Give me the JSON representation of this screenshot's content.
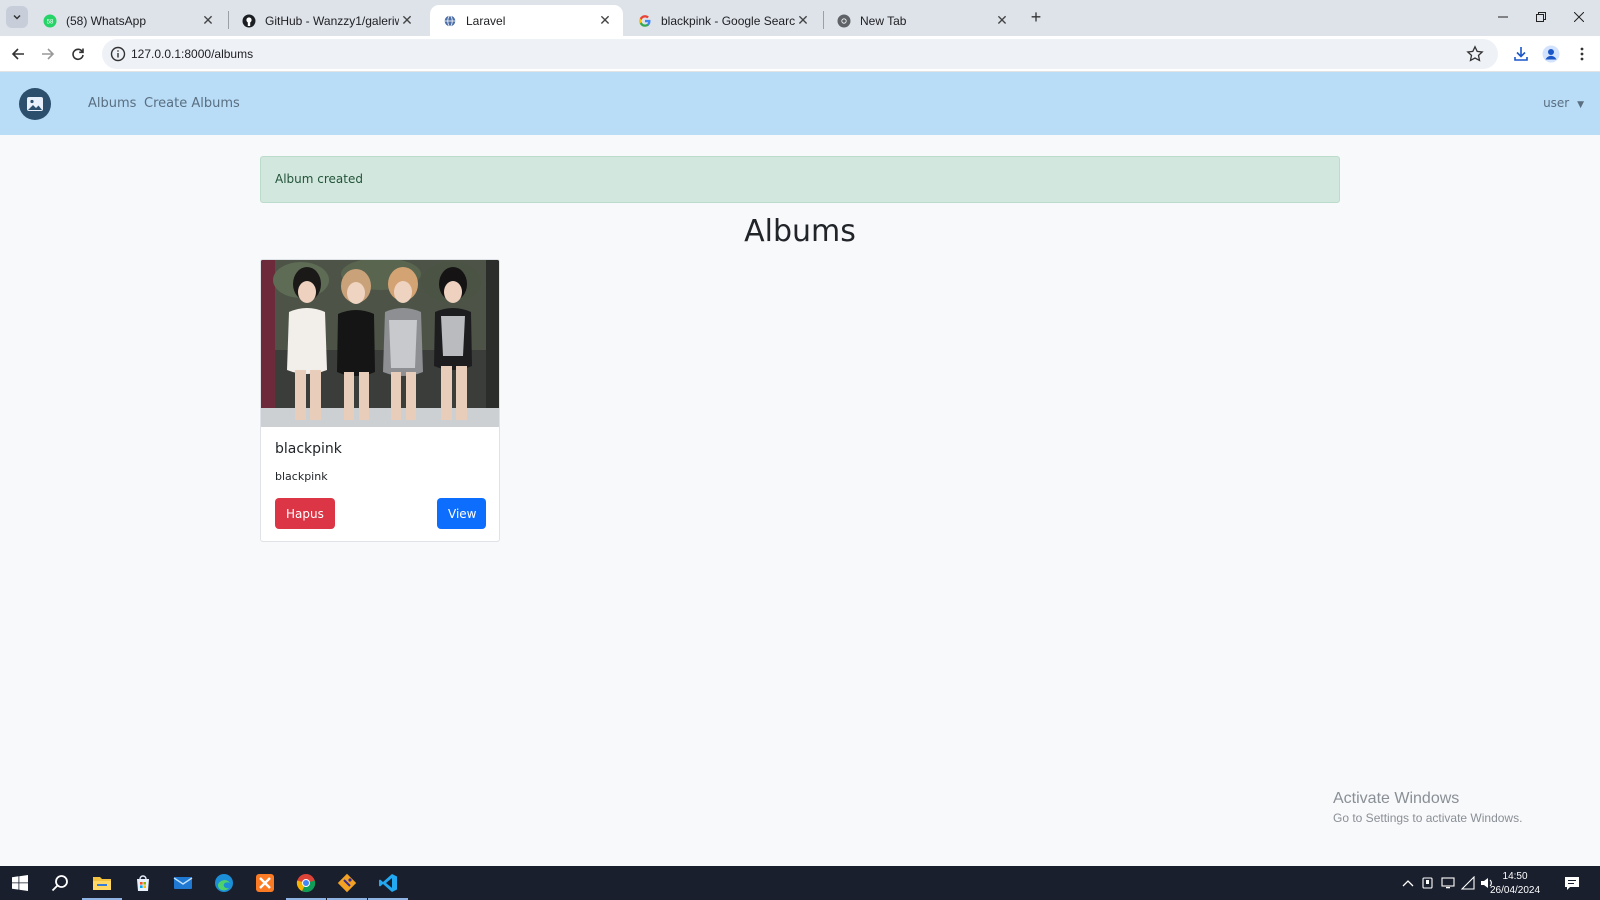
{
  "browser": {
    "tabs": [
      {
        "title": "(58) WhatsApp",
        "favicon": "whatsapp-icon",
        "active": false
      },
      {
        "title": "GitHub - Wanzzy1/galeriwahda",
        "favicon": "github-icon",
        "active": false
      },
      {
        "title": "Laravel",
        "favicon": "globe-icon",
        "active": true
      },
      {
        "title": "blackpink - Google Search",
        "favicon": "google-icon",
        "active": false
      },
      {
        "title": "New Tab",
        "favicon": "chrome-icon",
        "active": false
      }
    ],
    "url": "127.0.0.1:8000/albums"
  },
  "navbar": {
    "links": [
      "Albums",
      "Create Albums"
    ],
    "user": "user"
  },
  "alert": {
    "message": "Album created"
  },
  "page": {
    "title": "Albums"
  },
  "albums": [
    {
      "name": "blackpink",
      "description": "blackpink",
      "delete_label": "Hapus",
      "view_label": "View"
    }
  ],
  "watermark": {
    "line1": "Activate Windows",
    "line2": "Go to Settings to activate Windows."
  },
  "taskbar": {
    "apps": [
      "windows-start-icon",
      "search-icon",
      "file-explorer-icon",
      "microsoft-store-icon",
      "mail-icon",
      "edge-icon",
      "xampp-icon",
      "chrome-icon",
      "git-icon",
      "vscode-icon"
    ],
    "time": "14:50",
    "date": "26/04/2024"
  },
  "colors": {
    "navbar_bg": "#b9dcf7",
    "alert_bg": "#d2e7dd",
    "danger": "#dc3545",
    "primary": "#0d6efd"
  }
}
